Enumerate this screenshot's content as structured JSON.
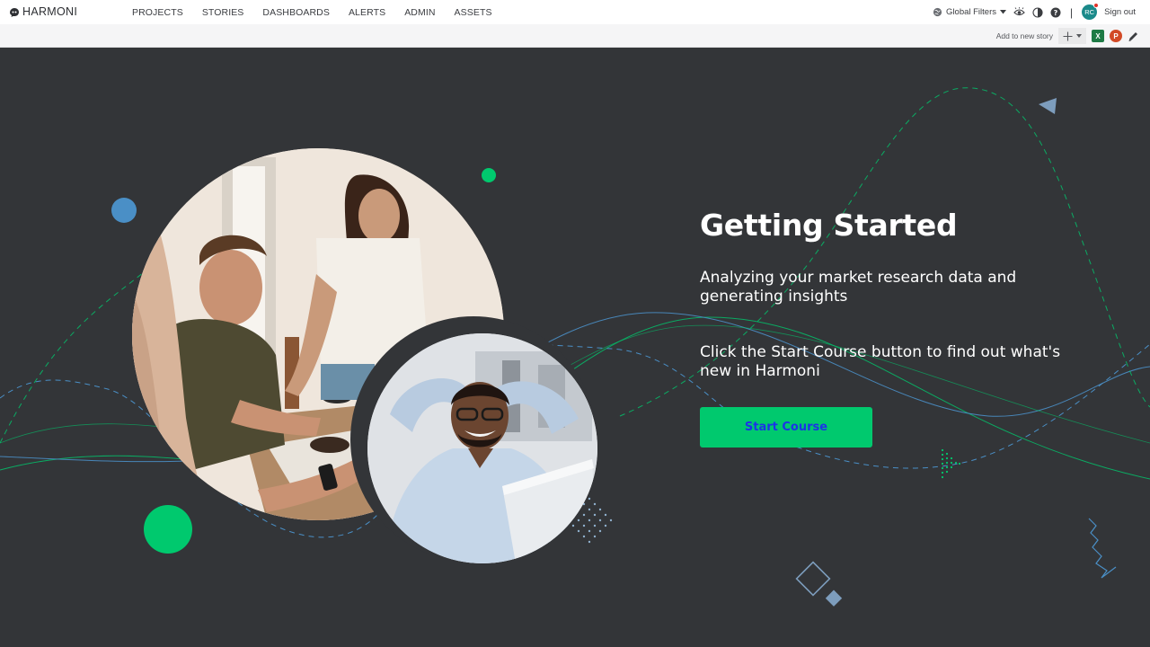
{
  "app": {
    "logo_text": "HARMONI"
  },
  "nav": {
    "items": [
      "PROJECTS",
      "STORIES",
      "DASHBOARDS",
      "ALERTS",
      "ADMIN",
      "ASSETS"
    ]
  },
  "topright": {
    "global_filters": "Global Filters",
    "avatar_initials": "RC",
    "signout": "Sign out"
  },
  "subbar": {
    "add_to_story": "Add to new story"
  },
  "hero": {
    "title": "Getting Started",
    "subtitle": "Analyzing your market research data and generating insights",
    "description": "Click the Start Course button to find out what's new in Harmoni",
    "cta_label": "Start Course"
  },
  "colors": {
    "background": "#333538",
    "accent": "#00c96e",
    "cta_text": "#1c34e6",
    "blue_accent": "#4a8fc6"
  },
  "icons": [
    "logo-mark-icon",
    "globe-icon",
    "chevron-down-icon",
    "eye-icon",
    "contrast-icon",
    "help-icon",
    "plus-icon",
    "excel-icon",
    "powerpoint-icon",
    "edit-pencil-icon"
  ]
}
